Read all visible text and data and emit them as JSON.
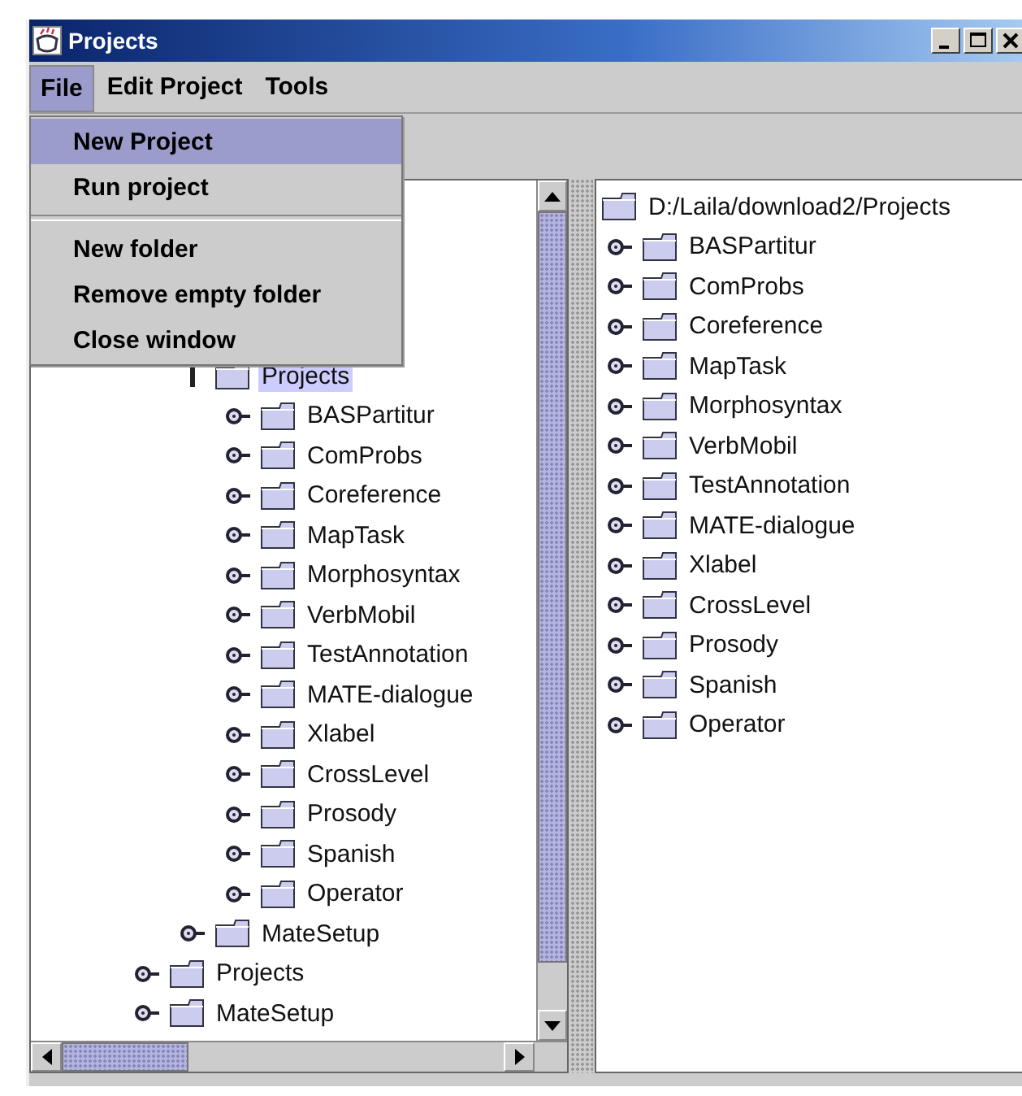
{
  "window": {
    "title": "Projects"
  },
  "menu_bar": [
    {
      "label": "File",
      "selected": true
    },
    {
      "label": "Edit Project",
      "selected": false
    },
    {
      "label": "Tools",
      "selected": false
    }
  ],
  "file_menu": [
    {
      "kind": "item",
      "label": "New Project",
      "selected": true
    },
    {
      "kind": "item",
      "label": "Run project",
      "selected": false
    },
    {
      "kind": "separator"
    },
    {
      "kind": "item",
      "label": "New folder",
      "selected": false
    },
    {
      "kind": "item",
      "label": "Remove empty folder",
      "selected": false
    },
    {
      "kind": "item",
      "label": "Close window",
      "selected": false
    }
  ],
  "left_tree": [
    {
      "children": [
        {
          "label": "Projects",
          "expanded": true,
          "selected": true,
          "children": [
            {
              "label": "BASPartitur",
              "expanded": false,
              "selected": false
            },
            {
              "label": "ComProbs",
              "expanded": false,
              "selected": false
            },
            {
              "label": "Coreference",
              "expanded": false,
              "selected": false
            },
            {
              "label": "MapTask",
              "expanded": false,
              "selected": false
            },
            {
              "label": "Morphosyntax",
              "expanded": false,
              "selected": false
            },
            {
              "label": "VerbMobil",
              "expanded": false,
              "selected": false
            },
            {
              "label": "TestAnnotation",
              "expanded": false,
              "selected": false
            },
            {
              "label": "MATE-dialogue",
              "expanded": false,
              "selected": false
            },
            {
              "label": "Xlabel",
              "expanded": false,
              "selected": false
            },
            {
              "label": "CrossLevel",
              "expanded": false,
              "selected": false
            },
            {
              "label": "Prosody",
              "expanded": false,
              "selected": false
            },
            {
              "label": "Spanish",
              "expanded": false,
              "selected": false
            },
            {
              "label": "Operator",
              "expanded": false,
              "selected": false
            }
          ]
        },
        {
          "label": "MateSetup",
          "expanded": false,
          "selected": false
        }
      ]
    },
    {
      "label": "Projects",
      "expanded": false,
      "selected": false
    },
    {
      "label": "MateSetup",
      "expanded": false,
      "selected": false
    }
  ],
  "right_tree": [
    {
      "label": "D:/Laila/download2/Projects",
      "children": [
        {
          "label": "BASPartitur",
          "expanded": false,
          "selected": false
        },
        {
          "label": "ComProbs",
          "expanded": false,
          "selected": false
        },
        {
          "label": "Coreference",
          "expanded": false,
          "selected": false
        },
        {
          "label": "MapTask",
          "expanded": false,
          "selected": false
        },
        {
          "label": "Morphosyntax",
          "expanded": false,
          "selected": false
        },
        {
          "label": "VerbMobil",
          "expanded": false,
          "selected": false
        },
        {
          "label": "TestAnnotation",
          "expanded": false,
          "selected": false
        },
        {
          "label": "MATE-dialogue",
          "expanded": false,
          "selected": false
        },
        {
          "label": "Xlabel",
          "expanded": false,
          "selected": false
        },
        {
          "label": "CrossLevel",
          "expanded": false,
          "selected": false
        },
        {
          "label": "Prosody",
          "expanded": false,
          "selected": false
        },
        {
          "label": "Spanish",
          "expanded": false,
          "selected": false
        },
        {
          "label": "Operator",
          "expanded": false,
          "selected": false
        }
      ]
    }
  ]
}
